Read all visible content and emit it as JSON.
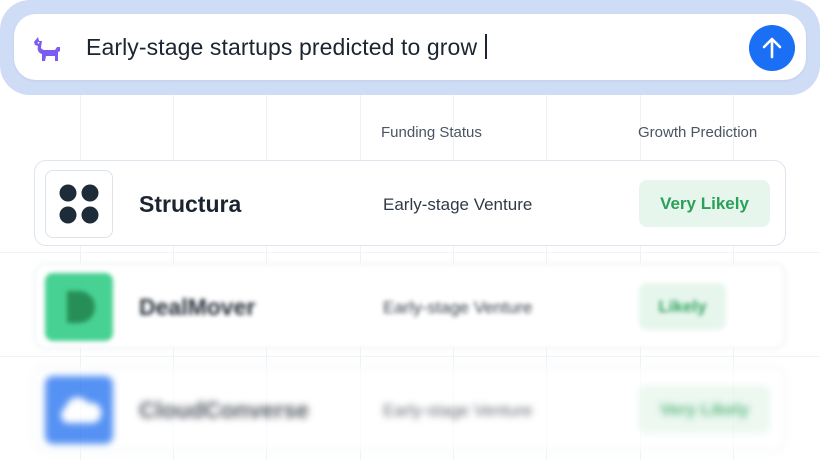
{
  "search": {
    "query": "Early-stage startups predicted to grow",
    "app_icon": "dog-icon",
    "send_icon": "arrow-up-icon",
    "accent_color": "#1b6ff5"
  },
  "table": {
    "columns": [
      "Funding Status",
      "Growth Prediction"
    ],
    "rows": [
      {
        "company": "Structura",
        "logo": "four-dots-icon",
        "funding": "Early-stage Venture",
        "prediction": "Very Likely"
      },
      {
        "company": "DealMover",
        "logo": "d-letter-icon",
        "funding": "Early-stage Venture",
        "prediction": "Likely"
      },
      {
        "company": "CloudConverse",
        "logo": "cloud-icon",
        "funding": "Early-stage Venture",
        "prediction": "Very Likely"
      }
    ]
  },
  "colors": {
    "badge_bg": "#e6f6ec",
    "badge_text": "#2aa05a",
    "dealmover_brand": "#3ecf8e",
    "cloud_brand": "#1e6ef0"
  }
}
